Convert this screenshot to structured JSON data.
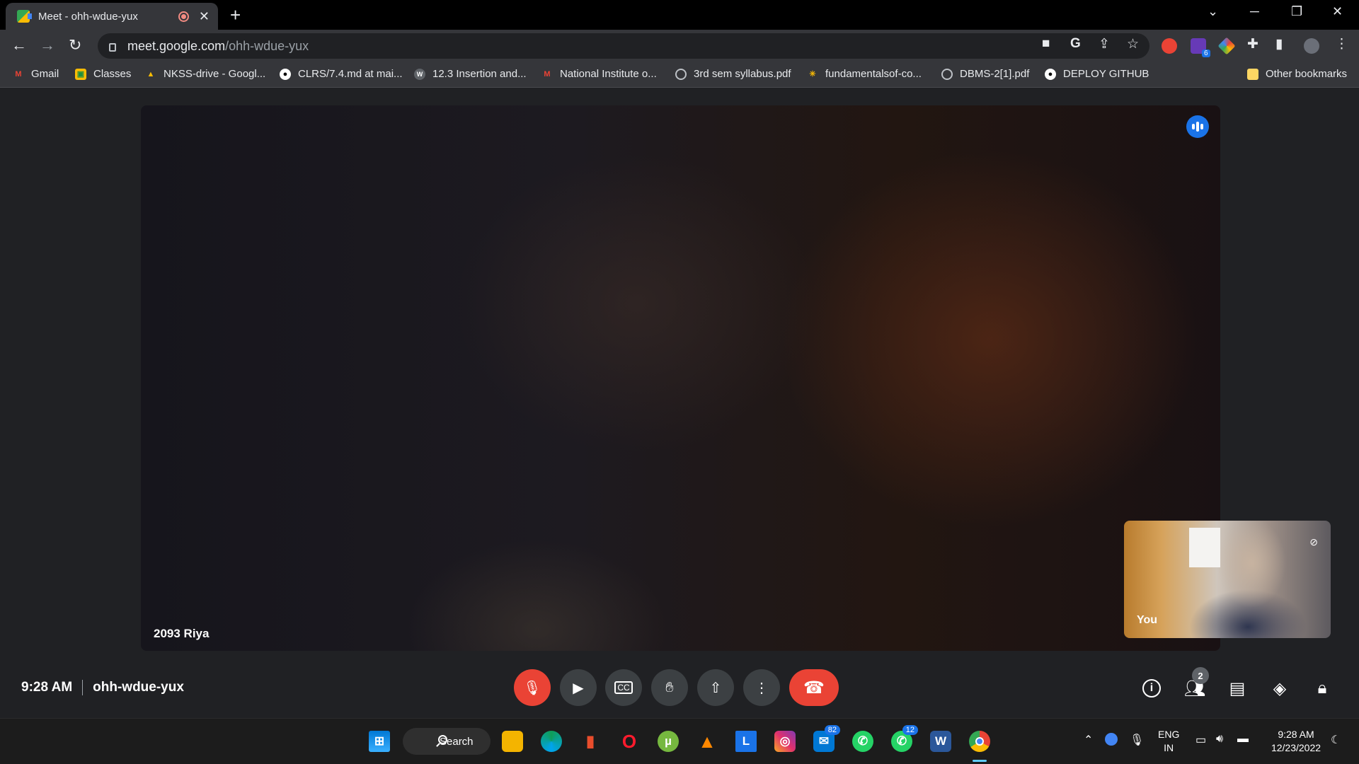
{
  "browser": {
    "tab_title": "Meet - ohh-wdue-yux",
    "new_tab": "+",
    "url_host": "meet.google.com",
    "url_path": "/ohh-wdue-yux",
    "window_controls": [
      "chevron-down",
      "minimize",
      "restore",
      "close"
    ]
  },
  "bookmarks": [
    {
      "label": "Gmail",
      "icon": "gmail-icon"
    },
    {
      "label": "Classes",
      "icon": "classroom-icon"
    },
    {
      "label": "NKSS-drive - Googl...",
      "icon": "drive-icon"
    },
    {
      "label": "CLRS/7.4.md at mai...",
      "icon": "github-icon"
    },
    {
      "label": "12.3 Insertion and...",
      "icon": "w-icon"
    },
    {
      "label": "National Institute o...",
      "icon": "gmail-icon"
    },
    {
      "label": "3rd sem syllabus.pdf",
      "icon": "globe-icon"
    },
    {
      "label": "fundamentalsof-co...",
      "icon": "sparkle-icon"
    },
    {
      "label": "DBMS-2[1].pdf",
      "icon": "globe-icon"
    },
    {
      "label": "DEPLOY GITHUB",
      "icon": "github-icon"
    }
  ],
  "other_bookmarks": "Other bookmarks",
  "extension_badge": "6",
  "meet": {
    "main_participant": "2093 Riya",
    "self_label": "You",
    "time": "9:28 AM",
    "meeting_code": "ohh-wdue-yux",
    "participants_count": "2"
  },
  "taskbar": {
    "search_label": "Search",
    "mail_badge": "82",
    "whatsapp_badge": "12",
    "language_line1": "ENG",
    "language_line2": "IN",
    "time": "9:28 AM",
    "date": "12/23/2022"
  },
  "colors": {
    "meet_background": "#202124",
    "control_gray": "#3c4043",
    "end_call_red": "#ea4335",
    "speaking_blue": "#1a73e8"
  }
}
